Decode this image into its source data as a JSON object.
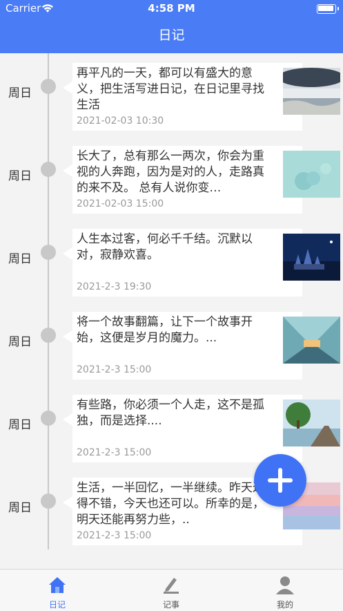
{
  "status_bar": {
    "carrier": "Carrier",
    "time": "4:58 PM"
  },
  "header": {
    "title": "日记"
  },
  "entries": [
    {
      "weekday": "周日",
      "text": "再平凡的一天，都可以有盛大的意义，把生活写进日记，在日记里寻找生活",
      "date": "2021-02-03 10:30",
      "image": "planet-landscape-image"
    },
    {
      "weekday": "周日",
      "text": "长大了，总有那么一两次，你会为重视的人奔跑，因为是对的人，走路真的来不及。 总有人说你变…",
      "date": "2021-02-03 15:00",
      "image": "teal-cloud-image"
    },
    {
      "weekday": "周日",
      "text": "人生本过客，何必千千结。沉默以对，寂静欢喜。",
      "date": "2021-2-3 19:30",
      "image": "night-castle-image"
    },
    {
      "weekday": "周日",
      "text": "将一个故事翻篇，让下一个故事开始，这便是岁月的魔力。...",
      "date": "2021-2-3 15:00",
      "image": "glass-bridge-image"
    },
    {
      "weekday": "周日",
      "text": "有些路，你必须一个人走，这不是孤独，而是选择....",
      "date": "2021-2-3 15:00",
      "image": "tree-pier-image"
    },
    {
      "weekday": "周日",
      "text": "生活，一半回忆，一半继续。昨天过得不错，今天也还可以。所幸的是，明天还能再努力些，..",
      "date": "2021-2-3 15:00",
      "image": "pastel-sky-image"
    }
  ],
  "fab": {
    "icon": "plus-icon"
  },
  "tabbar": {
    "tabs": [
      {
        "label": "日记",
        "icon": "home-icon",
        "active": true
      },
      {
        "label": "记事",
        "icon": "edit-note-icon",
        "active": false
      },
      {
        "label": "我的",
        "icon": "user-icon",
        "active": false
      }
    ]
  },
  "colors": {
    "accent": "#4a7cf6",
    "fab": "#3f72f5",
    "timeline": "#c8c8c8",
    "date_text": "#999999"
  }
}
